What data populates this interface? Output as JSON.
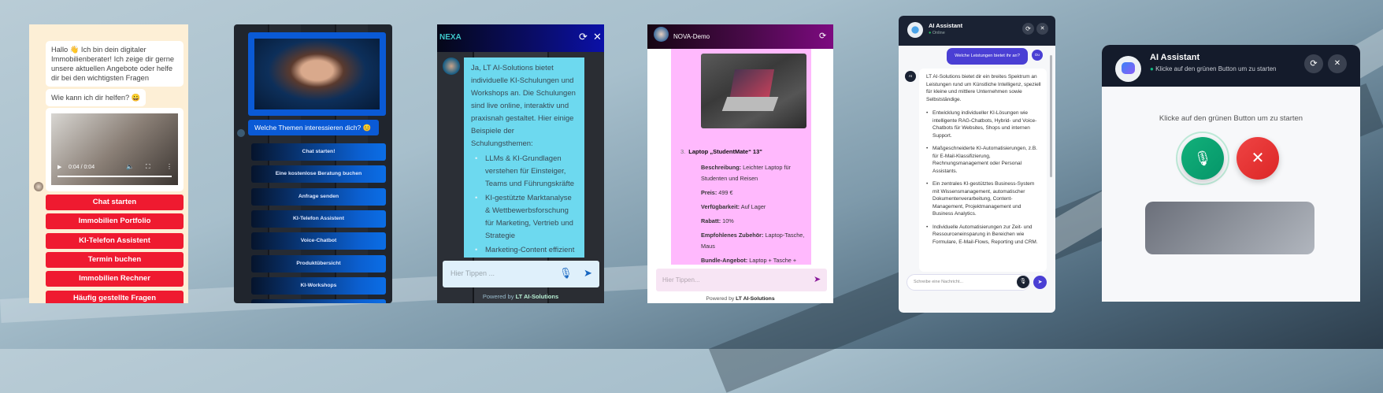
{
  "panel_realestate": {
    "greeting": "Hallo 👋 Ich bin dein digitaler Immobilienberater! Ich zeige dir gerne unsere aktuellen Angebote oder helfe dir bei den wichtigsten Fragen",
    "question": "Wie kann ich dir helfen? 😀",
    "video_time": "0:04 / 0:04",
    "buttons": [
      "Chat starten",
      "Immobilien Portfolio",
      "KI-Telefon Assistent",
      "Termin buchen",
      "Immobilien Rechner",
      "Häufig gestellte Fragen"
    ],
    "accent": "#ef1a30"
  },
  "panel_topics": {
    "question": "Welche Themen  interessieren dich? 😊",
    "buttons": [
      "Chat starten!",
      "Eine kostenlose Beratung buchen",
      "Anfrage senden",
      "KI-Telefon Assistent",
      "Voice-Chatbot",
      "Produktübersicht",
      "KI-Workshops"
    ]
  },
  "panel_nexa": {
    "title": "NEXA",
    "message_intro": "Ja, LT AI-Solutions bietet individuelle KI-Schulungen und Workshops an. Die Schulungen sind live online, interaktiv und praxisnah gestaltet. Hier einige Beispiele der Schulungsthemen:",
    "bullets": [
      "LLMs & KI-Grundlagen verstehen für Einsteiger, Teams und Führungskräfte",
      "KI-gestützte Marktanalyse & Wettbewerbsforschung für Marketing, Vertrieb und Strategie",
      "Marketing-Content effizient"
    ],
    "input_placeholder": "Hier Tippen ...",
    "powered_prefix": "Powered by ",
    "powered_brand": "LT AI-Solutions"
  },
  "panel_nova": {
    "title": "NOVA-Demo",
    "product_number": "3.",
    "product_name": "Laptop „StudentMate“ 13\"",
    "details": [
      {
        "label": "Beschreibung:",
        "value": " Leichter Laptop für Studenten und Reisen"
      },
      {
        "label": "Preis:",
        "value": " 499 €"
      },
      {
        "label": "Verfügbarkeit:",
        "value": " Auf Lager"
      },
      {
        "label": "Rabatt:",
        "value": " 10%"
      },
      {
        "label": "Empfohlenes Zubehör:",
        "value": " Laptop-Tasche, Maus"
      },
      {
        "label": "Bundle-Angebot:",
        "value": " Laptop + Tasche +"
      }
    ],
    "input_placeholder": "Hier Tippen...",
    "powered_prefix": "Powered by ",
    "powered_brand": "LT AI-Solutions"
  },
  "panel_assistant": {
    "title": "AI Assistant",
    "status": "Online",
    "user_avatar": "Du",
    "bot_avatar": "AI",
    "user_message": "Welche Leistungen bietet ihr an?",
    "bot_intro": "LT AI-Solutions bietet dir ein breites Spektrum an Leistungen rund um Künstliche Intelligenz, speziell für kleine und mittlere Unternehmen sowie Selbstständige.",
    "bullets": [
      "Entwicklung individueller KI-Lösungen wie intelligente RAG-Chatbots, Hybrid- und Voice-Chatbots für Websites, Shops und internen Support.",
      "Maßgeschneiderte KI-Automatisierungen, z.B. für E-Mail-Klassifizierung, Rechnungsmanagement oder Personal Assistants.",
      "Ein zentrales KI-gestütztes Business-System mit Wissensmanagement, automatischer Dokumentenverarbeitung, Content-Management, Projektmanagement und Business Analytics.",
      "Individuelle Automatisierungen zur Zeit- und Ressourceneinsparung in Bereichen wie Formulare, E-Mail-Flows, Reporting und CRM."
    ],
    "input_placeholder": "Schreibe eine Nachricht..."
  },
  "panel_voice": {
    "title": "AI Assistant",
    "status": "Klicke auf den grünen Button um zu starten",
    "prompt": "Klicke auf den grünen Button um zu starten"
  }
}
